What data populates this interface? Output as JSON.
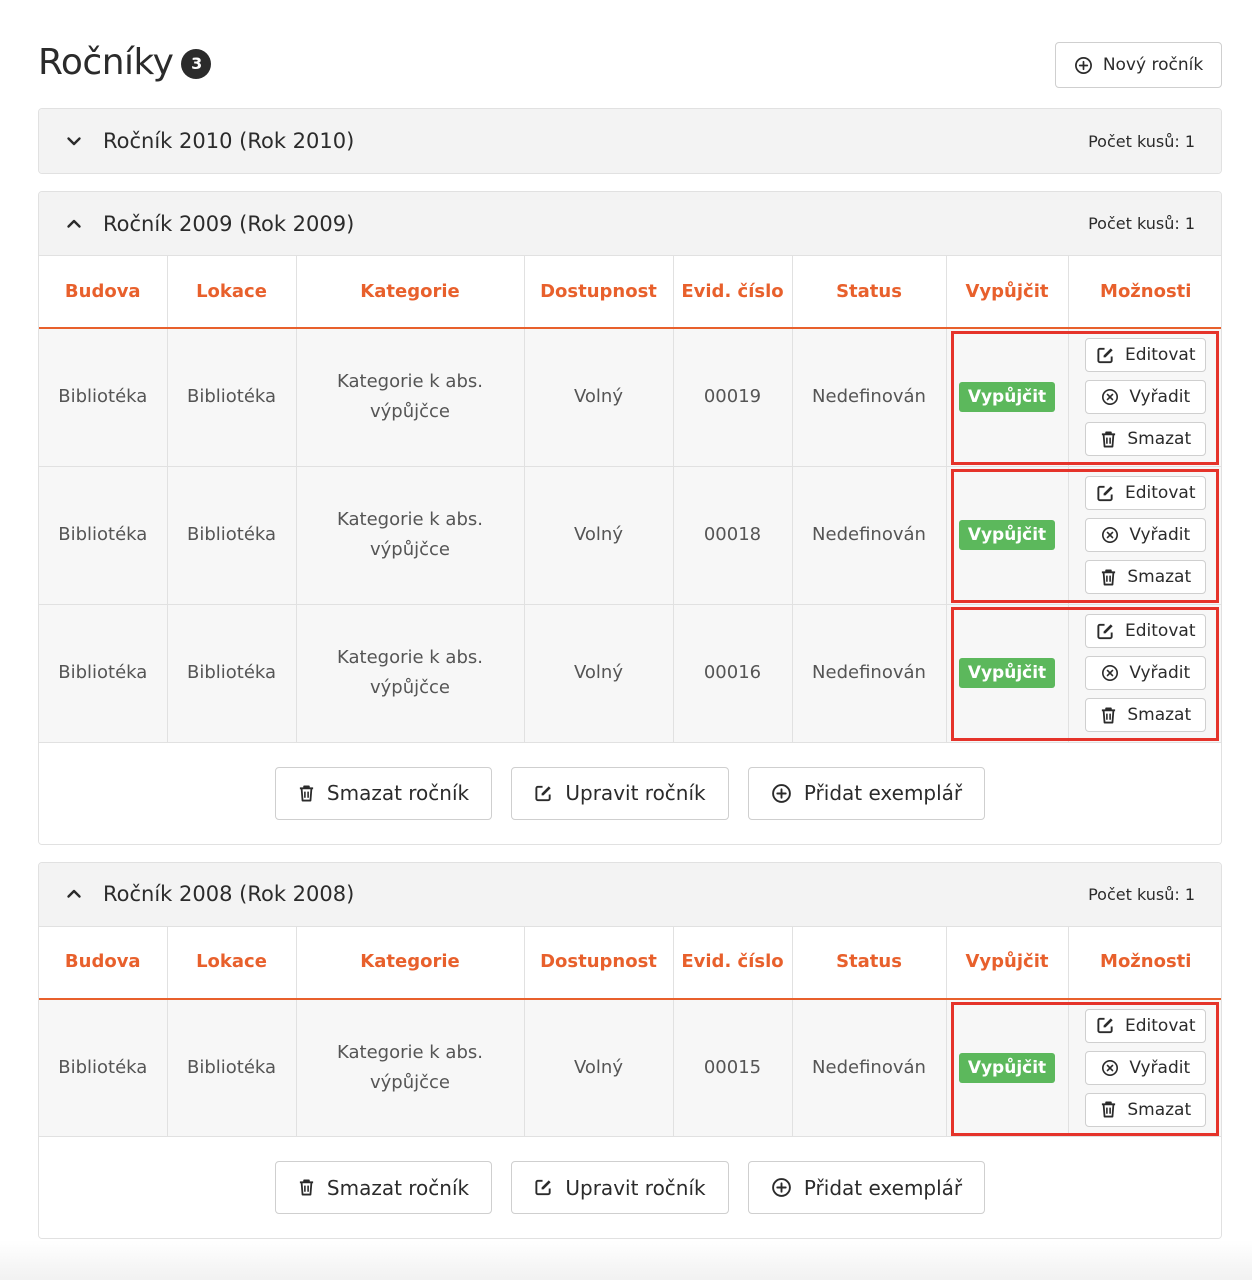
{
  "header": {
    "title": "Ročníky",
    "count": "3",
    "new_button": "Nový ročník"
  },
  "columns": [
    "Budova",
    "Lokace",
    "Kategorie",
    "Dostupnost",
    "Evid. číslo",
    "Status",
    "Vypůjčit",
    "Možnosti"
  ],
  "panels": [
    {
      "title": "Ročník 2010 (Rok 2010)",
      "count_label": "Počet kusů: 1",
      "expanded": false,
      "rows": []
    },
    {
      "title": "Ročník 2009 (Rok 2009)",
      "count_label": "Počet kusů: 1",
      "expanded": true,
      "rows": [
        {
          "budova": "Bibliotéka",
          "lokace": "Bibliotéka",
          "kategorie": "Kategorie k abs. výpůjčce",
          "dostupnost": "Volný",
          "evid": "00019",
          "status": "Nedefinován"
        },
        {
          "budova": "Bibliotéka",
          "lokace": "Bibliotéka",
          "kategorie": "Kategorie k abs. výpůjčce",
          "dostupnost": "Volný",
          "evid": "00018",
          "status": "Nedefinován"
        },
        {
          "budova": "Bibliotéka",
          "lokace": "Bibliotéka",
          "kategorie": "Kategorie k abs. výpůjčce",
          "dostupnost": "Volný",
          "evid": "00016",
          "status": "Nedefinován"
        }
      ]
    },
    {
      "title": "Ročník 2008 (Rok 2008)",
      "count_label": "Počet kusů: 1",
      "expanded": true,
      "rows": [
        {
          "budova": "Bibliotéka",
          "lokace": "Bibliotéka",
          "kategorie": "Kategorie k abs. výpůjčce",
          "dostupnost": "Volný",
          "evid": "00015",
          "status": "Nedefinován"
        }
      ]
    }
  ],
  "row_actions": {
    "borrow": "Vypůjčit",
    "edit": "Editovat",
    "discard": "Vyřadit",
    "delete": "Smazat"
  },
  "panel_actions": {
    "delete_volume": "Smazat ročník",
    "edit_volume": "Upravit ročník",
    "add_copy": "Přidat exemplář"
  },
  "colors": {
    "accent": "#e8602c",
    "success": "#5cb85c",
    "highlight": "#e5332a"
  }
}
